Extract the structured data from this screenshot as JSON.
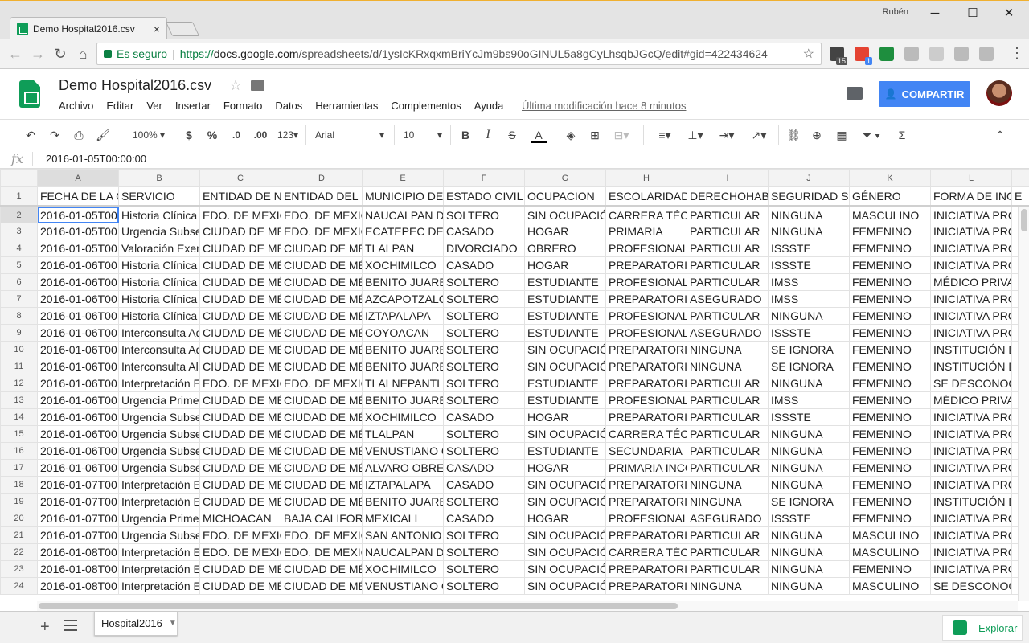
{
  "window": {
    "user": "Rubén",
    "minimize": "─",
    "maximize": "☐",
    "close": "✕"
  },
  "tab": {
    "title": "Demo Hospital2016.csv -",
    "close": "×"
  },
  "address": {
    "secure_label": "Es seguro",
    "url_scheme": "https://",
    "url_host": "docs.google.com",
    "url_path": "/spreadsheets/d/1ysIcKRxqxmBriYcJm9bs90oGINUL5a8gCyLhsqbJGcQ/edit#gid=422434624"
  },
  "extensions": [
    {
      "name": "calendar-extension-icon",
      "badge": "15",
      "color": "#444"
    },
    {
      "name": "todoist-extension-icon",
      "badge": "1",
      "color": "#e44332"
    },
    {
      "name": "drive-extension-icon",
      "color": "#1e8e3e"
    },
    {
      "name": "rss-extension-icon",
      "color": "#bbb"
    },
    {
      "name": "file-extension-icon",
      "color": "#ccc"
    },
    {
      "name": "circle-extension-icon",
      "color": "#bbb"
    },
    {
      "name": "puzzle-extension-icon",
      "color": "#bbb"
    }
  ],
  "doc": {
    "title": "Demo Hospital2016.csv",
    "last_modified": "Última modificación hace 8 minutos",
    "share_label": "COMPARTIR"
  },
  "menu": [
    "Archivo",
    "Editar",
    "Ver",
    "Insertar",
    "Formato",
    "Datos",
    "Herramientas",
    "Complementos",
    "Ayuda"
  ],
  "toolbar": {
    "zoom": "100%",
    "currency": "$",
    "percent": "%",
    "dec_less": ".0",
    "dec_more": ".00",
    "more_formats": "123",
    "font": "Arial",
    "font_size": "10",
    "bold": "B",
    "italic": "I",
    "strike": "S",
    "textcolor": "A",
    "sum": "Σ"
  },
  "formula": {
    "fx": "fx",
    "value": "2016-01-05T00:00:00"
  },
  "columns": [
    "A",
    "B",
    "C",
    "D",
    "E",
    "F",
    "G",
    "H",
    "I",
    "J",
    "K",
    "L"
  ],
  "header_row": [
    "FECHA DE LA C",
    "SERVICIO",
    "ENTIDAD DE NA",
    "ENTIDAD DEL D",
    "MUNICIPIO DEL",
    "ESTADO CIVIL",
    "OCUPACION",
    "ESCOLARIDAD",
    "DERECHOHABI",
    "SEGURIDAD SO",
    "GÉNERO",
    "FORMA DE ING"
  ],
  "rows": [
    [
      "2016-01-05T00:0",
      "Historia Clínica H",
      "EDO. DE MEXICO",
      "EDO. DE MEXICO",
      "NAUCALPAN DE",
      "SOLTERO",
      "SIN OCUPACIÓN",
      "CARRERA TÉCN",
      "PARTICULAR",
      "NINGUNA",
      "MASCULINO",
      "INICIATIVA PRO"
    ],
    [
      "2016-01-05T00:0",
      "Urgencia Subsec",
      "CIUDAD DE MÉX",
      "EDO. DE MEXICO",
      "ECATEPEC DE M",
      "CASADO",
      "HOGAR",
      "PRIMARIA",
      "PARTICULAR",
      "NINGUNA",
      "FEMENINO",
      "INICIATIVA PRO"
    ],
    [
      "2016-01-05T00:0",
      "Valoración Exenc",
      "CIUDAD DE MÉX",
      "CIUDAD DE MÉX",
      "TLALPAN",
      "DIVORCIADO",
      "OBRERO",
      "PROFESIONAL",
      "PARTICULAR",
      "ISSSTE",
      "FEMENINO",
      "INICIATIVA PRO"
    ],
    [
      "2016-01-06T00:0",
      "Historia Clínica H",
      "CIUDAD DE MÉX",
      "CIUDAD DE MÉX",
      "XOCHIMILCO",
      "CASADO",
      "HOGAR",
      "PREPARATORIA",
      "PARTICULAR",
      "ISSSTE",
      "FEMENINO",
      "INICIATIVA PRO"
    ],
    [
      "2016-01-06T00:0",
      "Historia Clínica H",
      "CIUDAD DE MÉX",
      "CIUDAD DE MÉX",
      "BENITO JUAREZ",
      "SOLTERO",
      "ESTUDIANTE",
      "PROFESIONAL",
      "PARTICULAR",
      "IMSS",
      "FEMENINO",
      "MÉDICO PRIVAD"
    ],
    [
      "2016-01-06T00:0",
      "Historia Clínica H",
      "CIUDAD DE MÉX",
      "CIUDAD DE MÉX",
      "AZCAPOTZALCO",
      "SOLTERO",
      "ESTUDIANTE",
      "PREPARATORIA",
      "ASEGURADO",
      "IMSS",
      "FEMENINO",
      "INICIATIVA PRO"
    ],
    [
      "2016-01-06T00:0",
      "Historia Clínica H",
      "CIUDAD DE MÉX",
      "CIUDAD DE MÉX",
      "IZTAPALAPA",
      "SOLTERO",
      "ESTUDIANTE",
      "PROFESIONAL",
      "PARTICULAR",
      "NINGUNA",
      "FEMENINO",
      "INICIATIVA PRO"
    ],
    [
      "2016-01-06T00:0",
      "Interconsulta Adi",
      "CIUDAD DE MÉX",
      "CIUDAD DE MÉX",
      "COYOACAN",
      "SOLTERO",
      "ESTUDIANTE",
      "PROFESIONAL",
      "ASEGURADO",
      "ISSSTE",
      "FEMENINO",
      "INICIATIVA PRO"
    ],
    [
      "2016-01-06T00:0",
      "Interconsulta Adi",
      "CIUDAD DE MÉX",
      "CIUDAD DE MÉX",
      "BENITO JUAREZ",
      "SOLTERO",
      "SIN OCUPACIÓN",
      "PREPARATORIA",
      "NINGUNA",
      "SE IGNORA",
      "FEMENINO",
      "INSTITUCIÓN D"
    ],
    [
      "2016-01-06T00:0",
      "Interconsulta Alir",
      "CIUDAD DE MÉX",
      "CIUDAD DE MÉX",
      "BENITO JUAREZ",
      "SOLTERO",
      "SIN OCUPACIÓN",
      "PREPARATORIA",
      "NINGUNA",
      "SE IGNORA",
      "FEMENINO",
      "INSTITUCIÓN D"
    ],
    [
      "2016-01-06T00:0",
      "Interpretación El",
      "EDO. DE MEXICO",
      "EDO. DE MEXICO",
      "TLALNEPANTLA",
      "SOLTERO",
      "ESTUDIANTE",
      "PREPARATORIA",
      "PARTICULAR",
      "NINGUNA",
      "FEMENINO",
      "SE DESCONOCE"
    ],
    [
      "2016-01-06T00:0",
      "Urgencia Primera",
      "CIUDAD DE MÉX",
      "CIUDAD DE MÉX",
      "BENITO JUAREZ",
      "SOLTERO",
      "ESTUDIANTE",
      "PROFESIONAL",
      "PARTICULAR",
      "IMSS",
      "FEMENINO",
      "MÉDICO PRIVAD"
    ],
    [
      "2016-01-06T00:0",
      "Urgencia Subsec",
      "CIUDAD DE MÉX",
      "CIUDAD DE MÉX",
      "XOCHIMILCO",
      "CASADO",
      "HOGAR",
      "PREPARATORIA",
      "PARTICULAR",
      "ISSSTE",
      "FEMENINO",
      "INICIATIVA PRO"
    ],
    [
      "2016-01-06T00:0",
      "Urgencia Subsec",
      "CIUDAD DE MÉX",
      "CIUDAD DE MÉX",
      "TLALPAN",
      "SOLTERO",
      "SIN OCUPACIÓN",
      "CARRERA TÉCN",
      "PARTICULAR",
      "NINGUNA",
      "FEMENINO",
      "INICIATIVA PRO"
    ],
    [
      "2016-01-06T00:0",
      "Urgencia Subsec",
      "CIUDAD DE MÉX",
      "CIUDAD DE MÉX",
      "VENUSTIANO C",
      "SOLTERO",
      "ESTUDIANTE",
      "SECUNDARIA",
      "PARTICULAR",
      "NINGUNA",
      "FEMENINO",
      "INICIATIVA PRO"
    ],
    [
      "2016-01-06T00:0",
      "Urgencia Subsec",
      "CIUDAD DE MÉX",
      "CIUDAD DE MÉX",
      "ALVARO OBREG",
      "CASADO",
      "HOGAR",
      "PRIMARIA INCO",
      "PARTICULAR",
      "NINGUNA",
      "FEMENINO",
      "INICIATIVA PRO"
    ],
    [
      "2016-01-07T00:0",
      "Interpretación El",
      "CIUDAD DE MÉX",
      "CIUDAD DE MÉX",
      "IZTAPALAPA",
      "CASADO",
      "SIN OCUPACIÓN",
      "PREPARATORIA",
      "NINGUNA",
      "NINGUNA",
      "FEMENINO",
      "INICIATIVA PRO"
    ],
    [
      "2016-01-07T00:0",
      "Interpretación El",
      "CIUDAD DE MÉX",
      "CIUDAD DE MÉX",
      "BENITO JUAREZ",
      "SOLTERO",
      "SIN OCUPACIÓN",
      "PREPARATORIA",
      "NINGUNA",
      "SE IGNORA",
      "FEMENINO",
      "INSTITUCIÓN D"
    ],
    [
      "2016-01-07T00:0",
      "Urgencia Primera",
      "MICHOACAN",
      "BAJA CALIFORN",
      "MEXICALI",
      "CASADO",
      "HOGAR",
      "PROFESIONAL",
      "ASEGURADO",
      "ISSSTE",
      "FEMENINO",
      "INICIATIVA PRO"
    ],
    [
      "2016-01-07T00:0",
      "Urgencia Subsec",
      "EDO. DE MEXICO",
      "EDO. DE MEXICO",
      "SAN ANTONIO L",
      "SOLTERO",
      "SIN OCUPACIÓN",
      "PREPARATORIA",
      "PARTICULAR",
      "NINGUNA",
      "MASCULINO",
      "INICIATIVA PRO"
    ],
    [
      "2016-01-08T00:0",
      "Interpretación El",
      "EDO. DE MEXICO",
      "EDO. DE MEXICO",
      "NAUCALPAN DE",
      "SOLTERO",
      "SIN OCUPACIÓN",
      "CARRERA TÉCN",
      "PARTICULAR",
      "NINGUNA",
      "MASCULINO",
      "INICIATIVA PRO"
    ],
    [
      "2016-01-08T00:0",
      "Interpretación El",
      "CIUDAD DE MÉX",
      "CIUDAD DE MÉX",
      "XOCHIMILCO",
      "SOLTERO",
      "SIN OCUPACIÓN",
      "PREPARATORIA",
      "PARTICULAR",
      "NINGUNA",
      "FEMENINO",
      "INICIATIVA PRO"
    ],
    [
      "2016-01-08T00:0",
      "Interpretación El",
      "CIUDAD DE MÉX",
      "CIUDAD DE MÉX",
      "VENUSTIANO C",
      "SOLTERO",
      "SIN OCUPACIÓN",
      "PREPARATORIA",
      "NINGUNA",
      "NINGUNA",
      "MASCULINO",
      "SE DESCONOCE"
    ]
  ],
  "sheet": {
    "name": "Hospital2016",
    "add": "+",
    "explore_label": "Explorar"
  },
  "colors": {
    "brand_green": "#0f9d58",
    "share_blue": "#4285f4",
    "selection_blue": "#4285f4"
  }
}
